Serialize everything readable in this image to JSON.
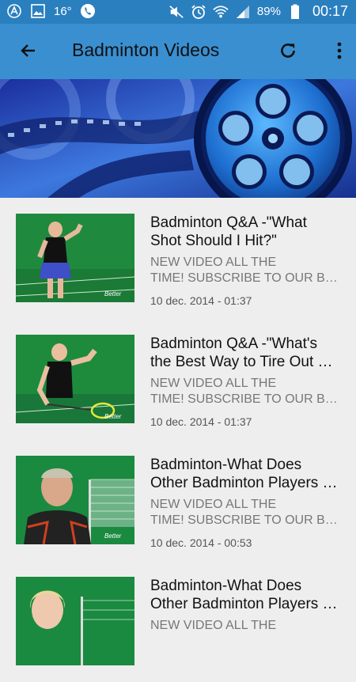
{
  "status_bar": {
    "temperature": "16°",
    "battery": "89%",
    "time": "00:17"
  },
  "app_bar": {
    "title": "Badminton Videos",
    "back_icon": "arrow-back-icon",
    "refresh_icon": "refresh-icon",
    "menu_icon": "more-vert-icon"
  },
  "videos": [
    {
      "title_line1": "Badminton Q&A -\"What",
      "title_line2": "Shot Should I Hit?\"",
      "desc_line1": "NEW VIDEO ALL THE",
      "desc_line2": "TIME! SUBSCRIBE TO OUR B…",
      "date": "10 dec. 2014 - 01:37"
    },
    {
      "title_line1": "Badminton Q&A -\"What's",
      "title_line2": "the Best Way to Tire Out …",
      "desc_line1": "NEW VIDEO ALL THE",
      "desc_line2": "TIME! SUBSCRIBE TO OUR B…",
      "date": "10 dec. 2014 - 01:37"
    },
    {
      "title_line1": "Badminton-What Does",
      "title_line2": "Other Badminton Players …",
      "desc_line1": "NEW VIDEO ALL THE",
      "desc_line2": "TIME! SUBSCRIBE TO OUR B…",
      "date": "10 dec. 2014 - 00:53"
    },
    {
      "title_line1": "Badminton-What Does",
      "title_line2": "Other Badminton Players …",
      "desc_line1": "NEW VIDEO ALL THE",
      "desc_line2": "",
      "date": ""
    }
  ]
}
